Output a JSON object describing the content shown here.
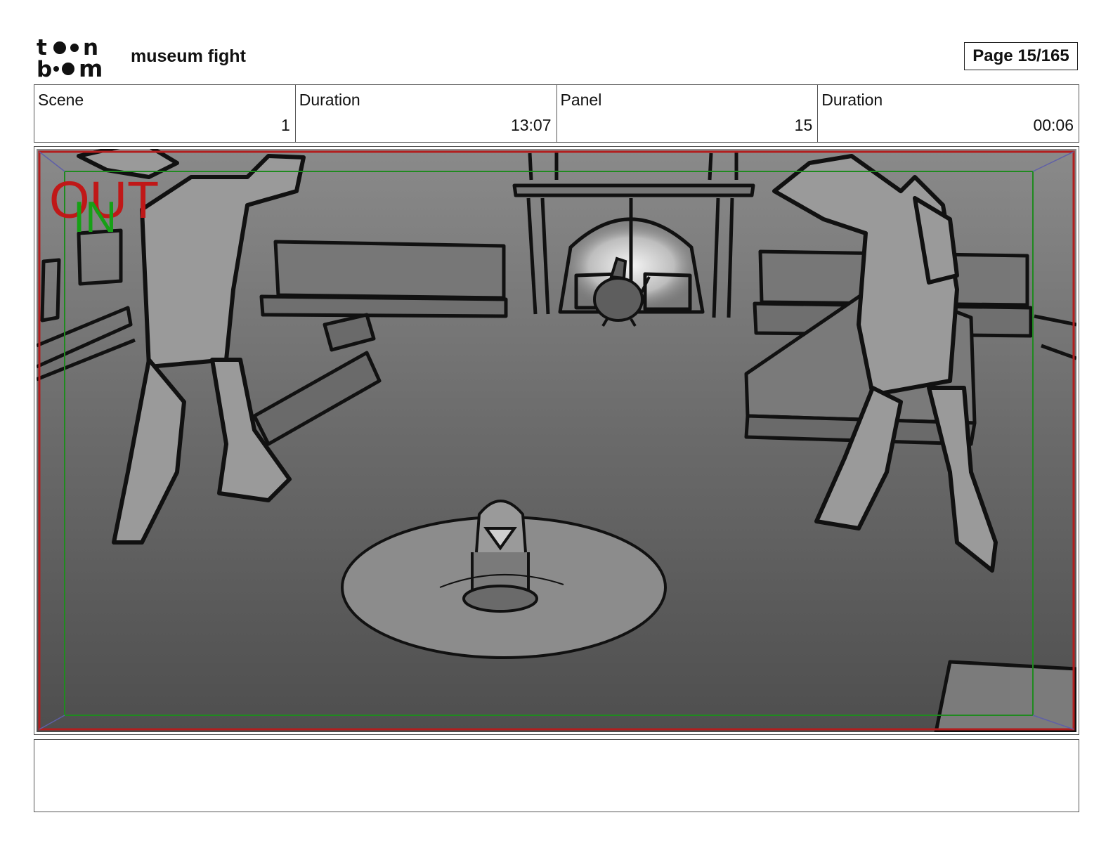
{
  "header": {
    "logo": {
      "line1": "toon",
      "line2": "boom",
      "icon": "toon-boom-logo"
    },
    "project_title": "museum fight",
    "page": {
      "label": "Page",
      "value": "15/165"
    }
  },
  "info": {
    "scene": {
      "label": "Scene",
      "value": "1"
    },
    "scene_duration": {
      "label": "Duration",
      "value": "13:07"
    },
    "panel": {
      "label": "Panel",
      "value": "15"
    },
    "panel_duration": {
      "label": "Duration",
      "value": "00:06"
    }
  },
  "panel_image": {
    "overlay_out": "OUT",
    "overlay_in": "IN",
    "colors": {
      "safe_out": "#b21e1e",
      "safe_in": "#1f8a1f"
    }
  },
  "notes": {
    "text": ""
  }
}
